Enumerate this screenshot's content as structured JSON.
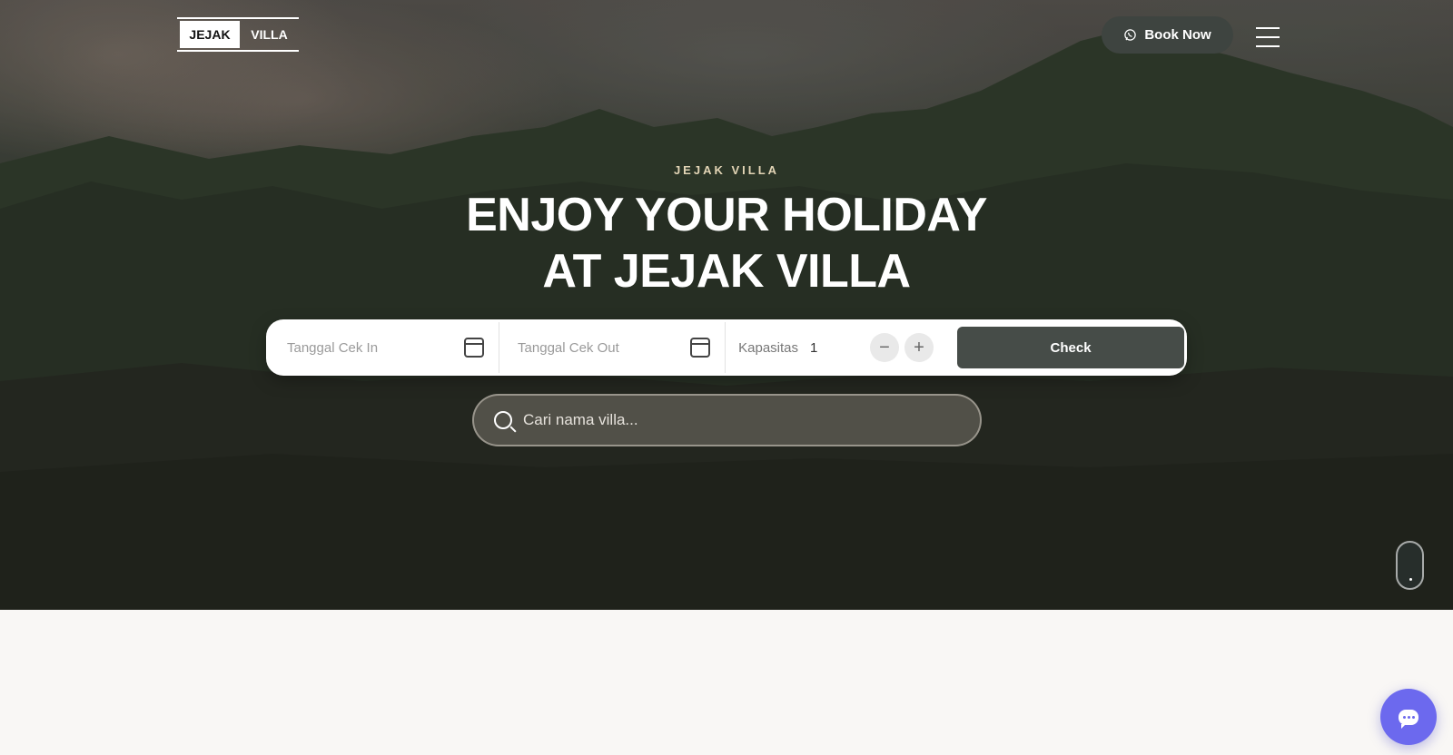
{
  "header": {
    "logo_left": "JEJAK",
    "logo_right": "VILLA",
    "book_label": "Book Now",
    "menu_icon": "hamburger-icon"
  },
  "hero": {
    "eyebrow": "JEJAK VILLA",
    "title_line1": "ENJOY YOUR HOLIDAY",
    "title_line2": "AT JEJAK VILLA"
  },
  "booking": {
    "checkin_placeholder": "Tanggal Cek In",
    "checkout_placeholder": "Tanggal Cek Out",
    "capacity_label": "Kapasitas",
    "capacity_value": "1",
    "decrement": "−",
    "increment": "+",
    "check_label": "Check"
  },
  "search": {
    "placeholder": "Cari nama villa..."
  },
  "colors": {
    "accent": "#464c48",
    "chat": "#6c69ee",
    "eyebrow": "#e3d5b6"
  }
}
